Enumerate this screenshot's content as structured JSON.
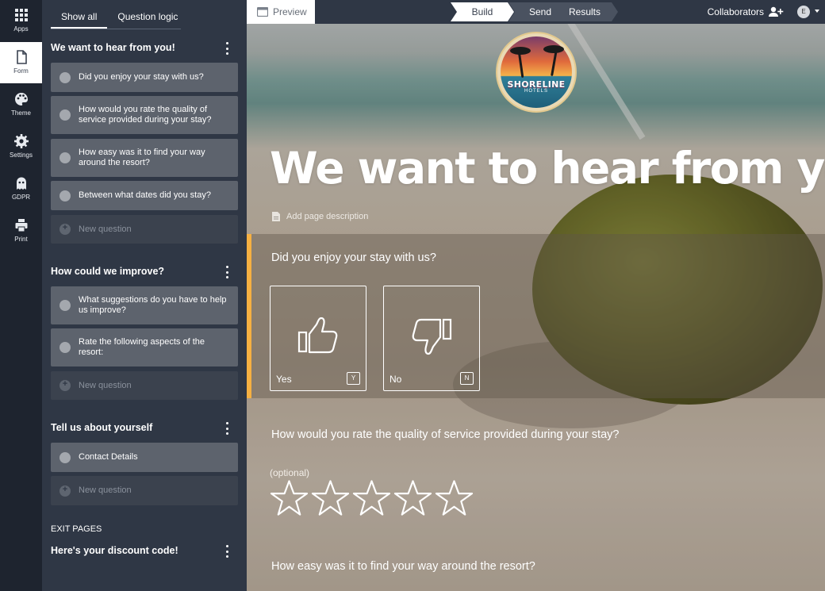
{
  "rail": {
    "items": [
      {
        "label": "Apps",
        "icon": "apps-grid-icon"
      },
      {
        "label": "Form",
        "icon": "document-icon"
      },
      {
        "label": "Theme",
        "icon": "palette-icon"
      },
      {
        "label": "Settings",
        "icon": "gear-icon"
      },
      {
        "label": "GDPR",
        "icon": "ghost-icon"
      },
      {
        "label": "Print",
        "icon": "printer-icon"
      }
    ],
    "active": "Form"
  },
  "panel": {
    "tabs": [
      {
        "label": "Show all",
        "active": true
      },
      {
        "label": "Question logic",
        "active": false
      }
    ],
    "pages": [
      {
        "title": "We want to hear from you!",
        "questions": [
          "Did you enjoy your stay with us?",
          "How would you rate the quality of service provided during your stay?",
          "How easy was it to find your way around the resort?",
          "Between what dates did you stay?"
        ],
        "new_question": "New question"
      },
      {
        "title": "How could we improve?",
        "questions": [
          "What suggestions do you have to help us improve?",
          "Rate the following aspects of the resort:"
        ],
        "new_question": "New question"
      },
      {
        "title": "Tell us about yourself",
        "questions": [
          "Contact Details"
        ],
        "new_question": "New question"
      }
    ],
    "exit_pages_label": "EXIT PAGES",
    "exit_pages": [
      {
        "title": "Here's your discount code!"
      }
    ]
  },
  "topbar": {
    "preview_label": "Preview",
    "steps": [
      "Build",
      "Send",
      "Results"
    ],
    "active_step": "Build",
    "collaborators_label": "Collaborators",
    "avatar_initial": "E"
  },
  "form": {
    "logo": {
      "brand": "SHORELINE",
      "sub": "HOTELS"
    },
    "page_title": "We want to hear from you!",
    "page_description_placeholder": "Add page description",
    "questions": [
      {
        "title": "Did you enjoy your stay with us?",
        "type": "thumbs",
        "options": [
          {
            "label": "Yes",
            "key": "Y"
          },
          {
            "label": "No",
            "key": "N"
          }
        ]
      },
      {
        "title": "How would you rate the quality of service provided during your stay?",
        "type": "rating",
        "optional_label": "(optional)",
        "max_stars": 5
      },
      {
        "title": "How easy was it to find your way around the resort?"
      }
    ]
  },
  "colors": {
    "accent": "#f6b042",
    "rail_bg": "#1e242f",
    "panel_bg": "#2f3745",
    "card_bg": "#5d636d"
  }
}
